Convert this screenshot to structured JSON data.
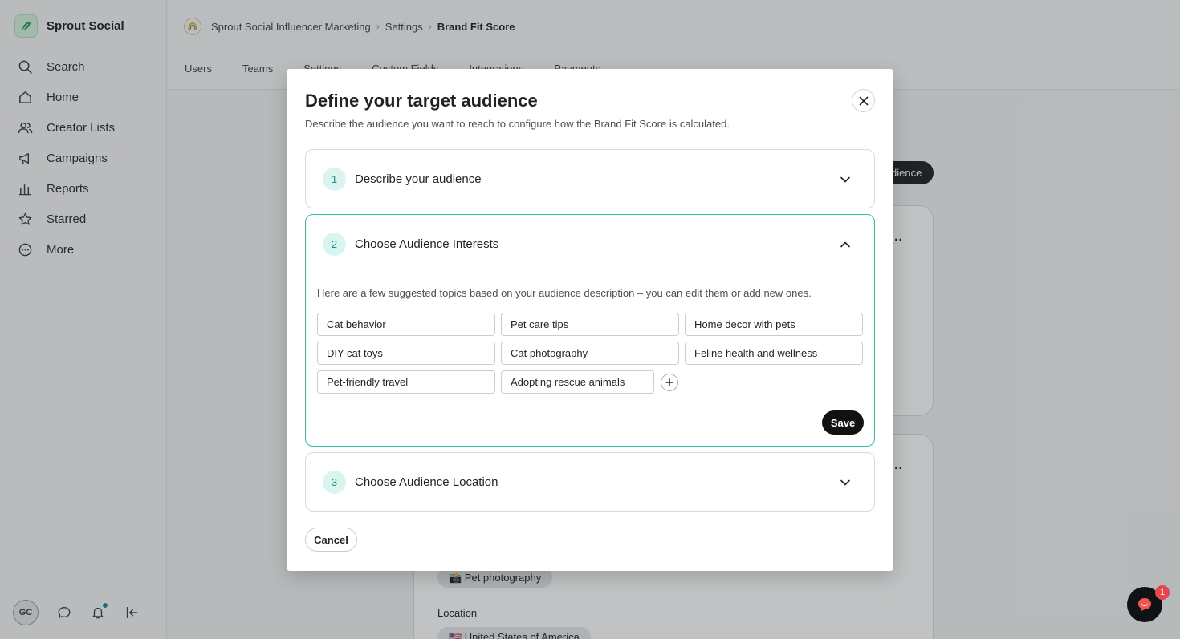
{
  "app": {
    "brand_name": "Sprout Social"
  },
  "sidebar": {
    "items": [
      {
        "label": "Search",
        "icon": "search-icon"
      },
      {
        "label": "Home",
        "icon": "home-icon"
      },
      {
        "label": "Creator Lists",
        "icon": "users-icon"
      },
      {
        "label": "Campaigns",
        "icon": "megaphone-icon"
      },
      {
        "label": "Reports",
        "icon": "bar-chart-icon"
      },
      {
        "label": "Starred",
        "icon": "star-icon"
      },
      {
        "label": "More",
        "icon": "more-circle-icon"
      }
    ],
    "avatar_initials": "GC"
  },
  "header": {
    "breadcrumb": [
      "Sprout Social Influencer Marketing",
      "Settings",
      "Brand Fit Score"
    ],
    "tabs": [
      "Users",
      "Teams",
      "Settings",
      "Custom Fields",
      "Integrations",
      "Payments"
    ]
  },
  "background": {
    "pill_label": "dience",
    "card_menu": "...",
    "tag_pet_photography": "📸 Pet photography",
    "location_label": "Location",
    "tag_location": "🇺🇸 United States of America"
  },
  "modal": {
    "title": "Define your target audience",
    "subtitle": "Describe the audience you want to reach to configure how the Brand Fit Score is calculated.",
    "steps": [
      {
        "number": "1",
        "title": "Describe your audience"
      },
      {
        "number": "2",
        "title": "Choose Audience Interests"
      },
      {
        "number": "3",
        "title": "Choose Audience Location"
      }
    ],
    "interests_hint": "Here are a few suggested topics based on your audience description – you can edit them or add new ones.",
    "interests": [
      "Cat behavior",
      "Pet care tips",
      "Home decor with pets",
      "DIY cat toys",
      "Cat photography",
      "Feline health and wellness",
      "Pet-friendly travel",
      "Adopting rescue animals"
    ],
    "save_label": "Save",
    "cancel_label": "Cancel"
  },
  "chat": {
    "badge_count": "1"
  },
  "colors": {
    "accent_teal": "#2fbfad",
    "badge_red": "#e9434b",
    "primary_button": "#111111"
  }
}
